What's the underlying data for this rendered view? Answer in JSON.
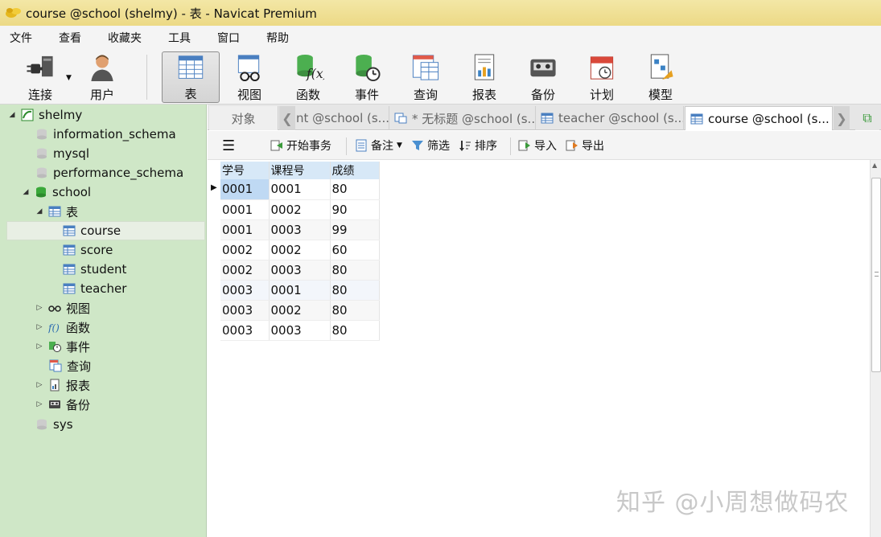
{
  "window": {
    "title": "course @school (shelmy) - 表 - Navicat Premium"
  },
  "menu": [
    "文件",
    "查看",
    "收藏夹",
    "工具",
    "窗口",
    "帮助"
  ],
  "toolbar": {
    "connect": "连接",
    "user": "用户",
    "table": "表",
    "view": "视图",
    "function": "函数",
    "event": "事件",
    "query": "查询",
    "report": "报表",
    "backup": "备份",
    "schedule": "计划",
    "model": "模型"
  },
  "sidebar": {
    "connection": "shelmy",
    "databases": [
      "information_schema",
      "mysql",
      "performance_schema",
      "school",
      "sys"
    ],
    "school_children": {
      "tables_label": "表",
      "tables": [
        "course",
        "score",
        "student",
        "teacher"
      ],
      "views_label": "视图",
      "functions_label": "函数",
      "events_label": "事件",
      "queries_label": "查询",
      "reports_label": "报表",
      "backups_label": "备份"
    }
  },
  "tabs": {
    "objects": "对象",
    "tab1": "nt @school (s...",
    "tab2": "* 无标题 @school (s...",
    "tab3": "teacher @school (s...",
    "tab4": "course @school (s..."
  },
  "table_toolbar": {
    "begin_transaction": "开始事务",
    "memo": "备注",
    "filter": "筛选",
    "sort": "排序",
    "import": "导入",
    "export": "导出"
  },
  "grid": {
    "columns": [
      "学号",
      "课程号",
      "成绩"
    ],
    "rows": [
      [
        "0001",
        "0001",
        "80"
      ],
      [
        "0001",
        "0002",
        "90"
      ],
      [
        "0001",
        "0003",
        "99"
      ],
      [
        "0002",
        "0002",
        "60"
      ],
      [
        "0002",
        "0003",
        "80"
      ],
      [
        "0003",
        "0001",
        "80"
      ],
      [
        "0003",
        "0002",
        "80"
      ],
      [
        "0003",
        "0003",
        "80"
      ]
    ]
  },
  "watermark": "知乎 @小周想做码农",
  "colors": {
    "sidebar": "#cfe7c7",
    "title_bar": "#ecd985",
    "header": "#d7e8f7",
    "selection": "#bfd9f3"
  }
}
